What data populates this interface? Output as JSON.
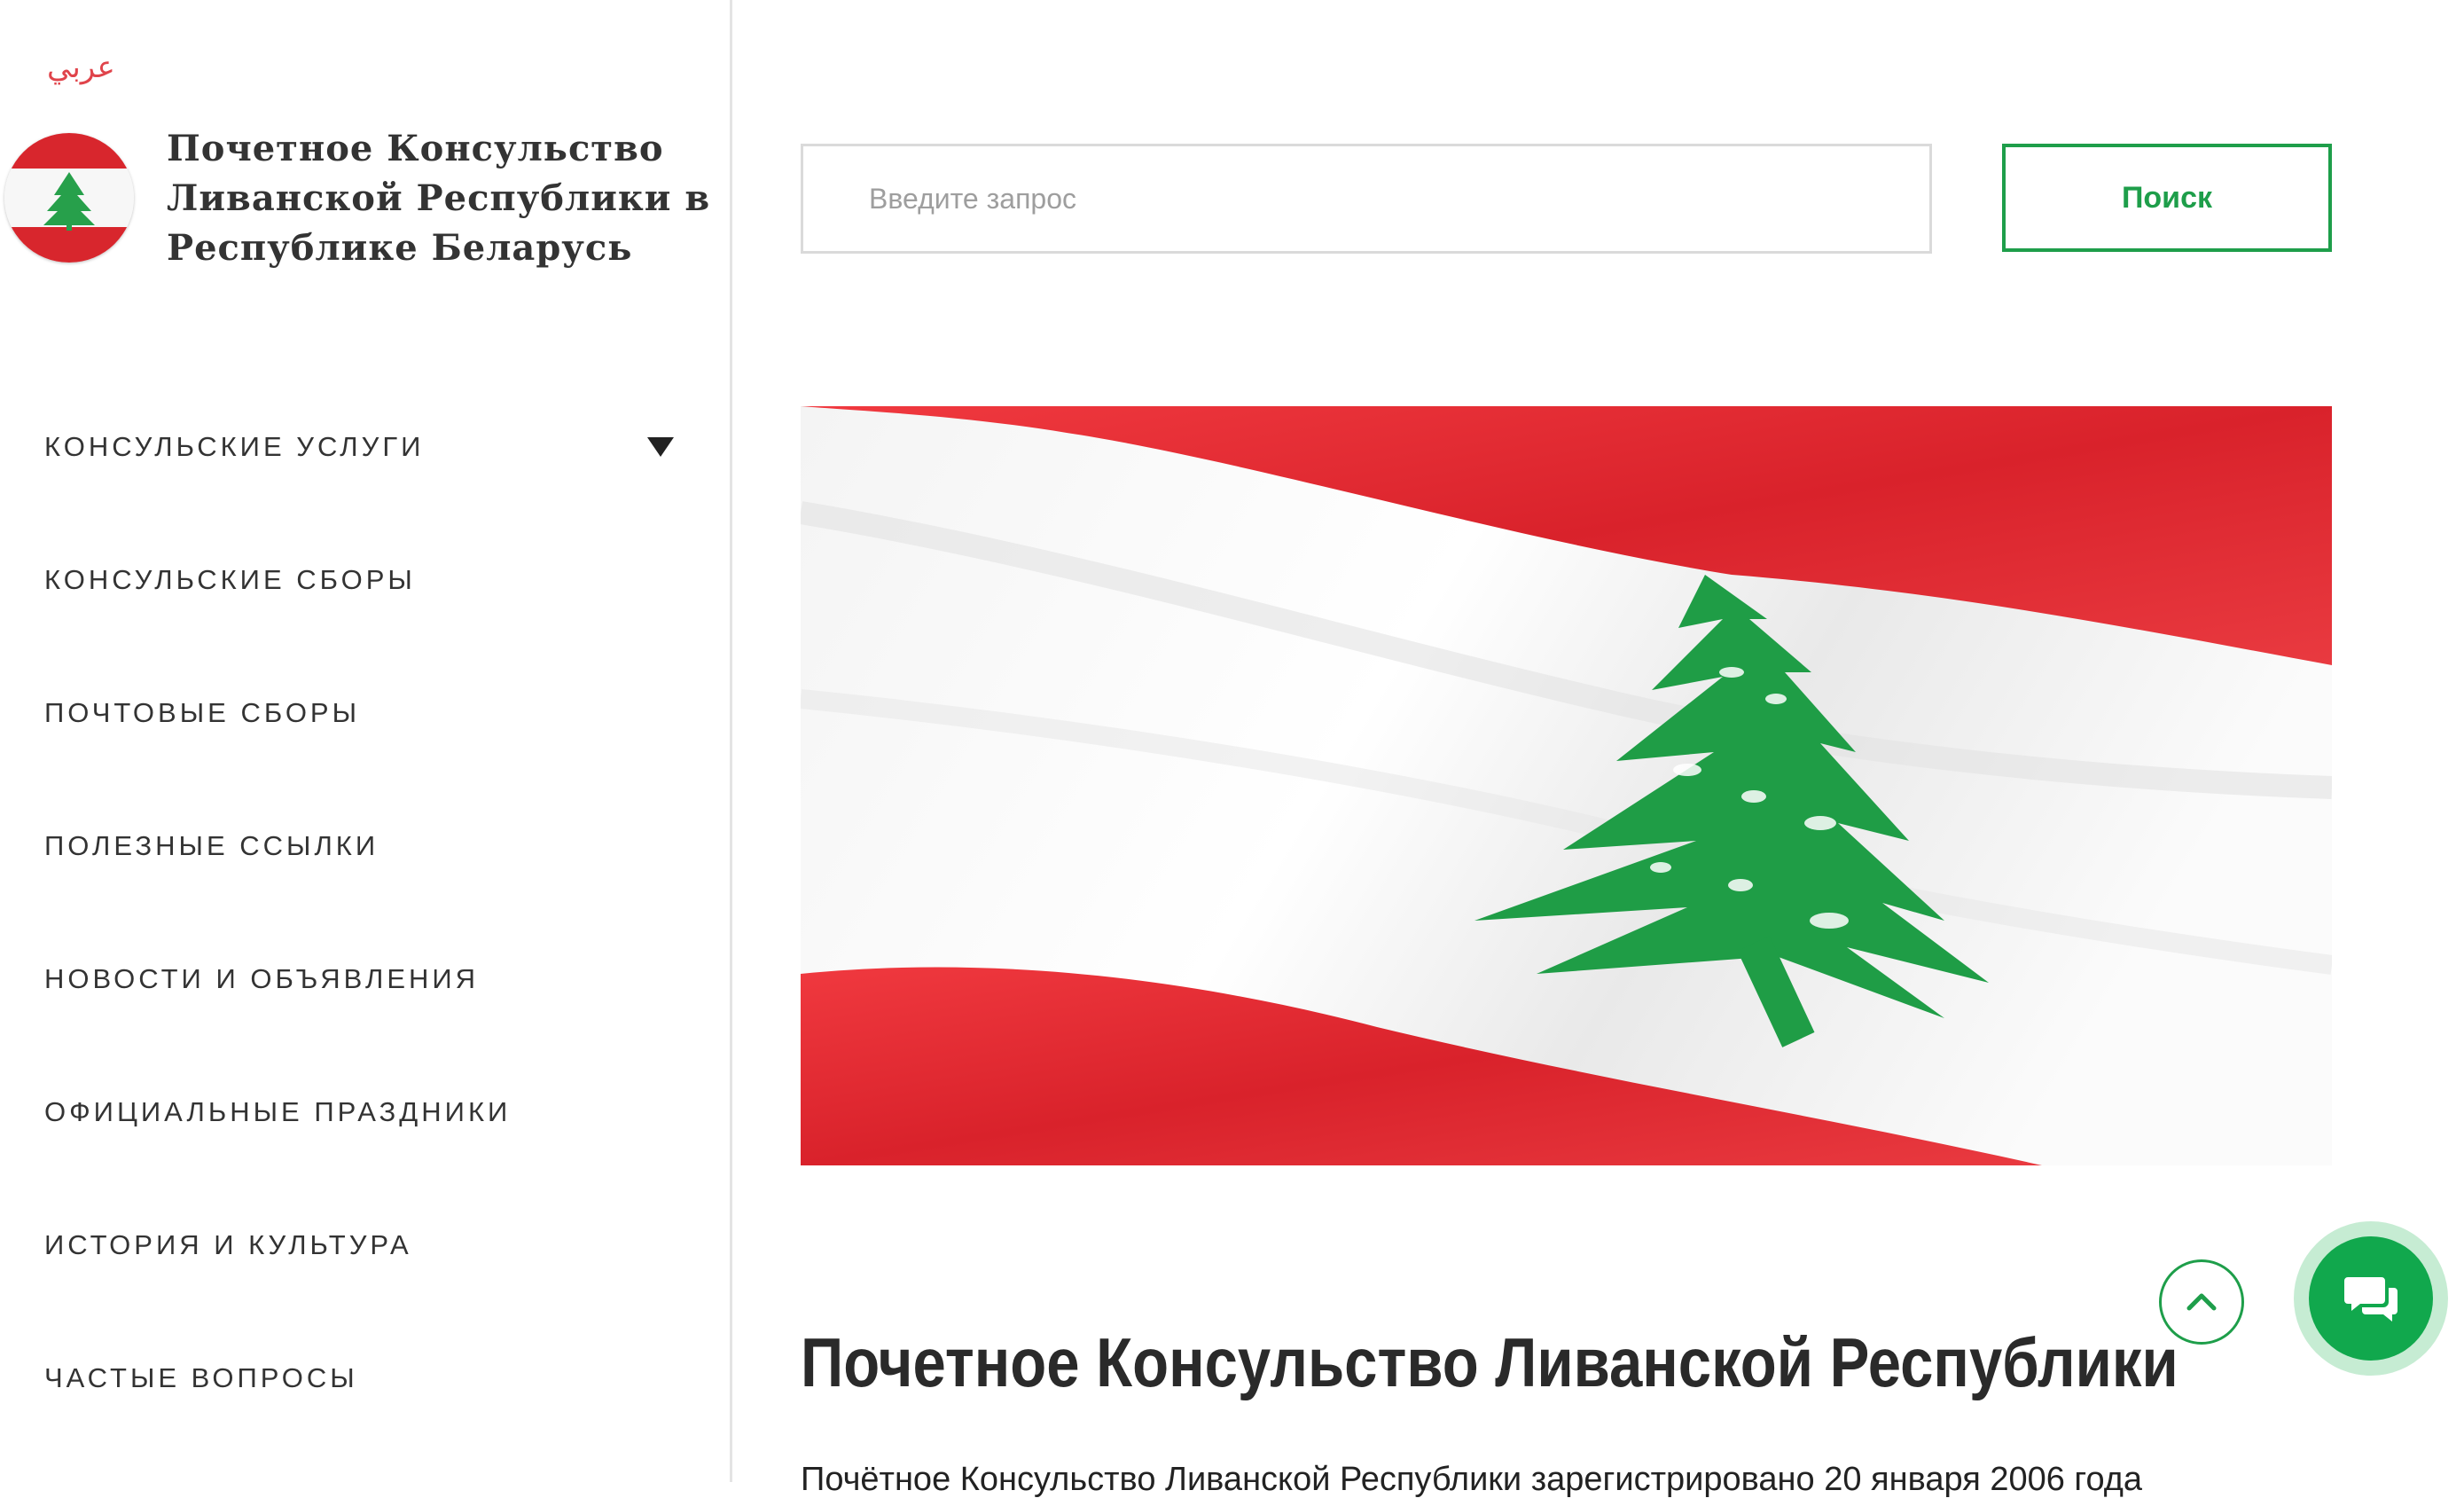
{
  "language_link": "عربي",
  "brand": {
    "title": "Почетное Консульство Ливанской Республики в Республике Беларусь"
  },
  "nav": {
    "items": [
      {
        "label": "КОНСУЛЬСКИЕ УСЛУГИ",
        "has_dropdown": true
      },
      {
        "label": "КОНСУЛЬСКИЕ СБОРЫ"
      },
      {
        "label": "ПОЧТОВЫЕ СБОРЫ"
      },
      {
        "label": "ПОЛЕЗНЫЕ ССЫЛКИ"
      },
      {
        "label": "НОВОСТИ И ОБЪЯВЛЕНИЯ"
      },
      {
        "label": "ОФИЦИАЛЬНЫЕ ПРАЗДНИКИ"
      },
      {
        "label": "ИСТОРИЯ И КУЛЬТУРА"
      },
      {
        "label": "ЧАСТЫЕ ВОПРОСЫ"
      }
    ]
  },
  "search": {
    "placeholder": "Введите запрос",
    "value": "",
    "button_label": "Поиск"
  },
  "main": {
    "heading": "Почетное Консульство Ливанской Республики",
    "intro": "Почётное Консульство Ливанской Республики зарегистрировано 20 января 2006 года"
  },
  "icons": {
    "dropdown": "caret-down-icon",
    "scroll_top": "chevron-up-icon",
    "chat": "chat-bubbles-icon"
  },
  "colors": {
    "accent_green": "#1e9e4a",
    "flag_red": "#e3262f",
    "cedar_green": "#21a04a",
    "link_red": "#e0444b"
  }
}
